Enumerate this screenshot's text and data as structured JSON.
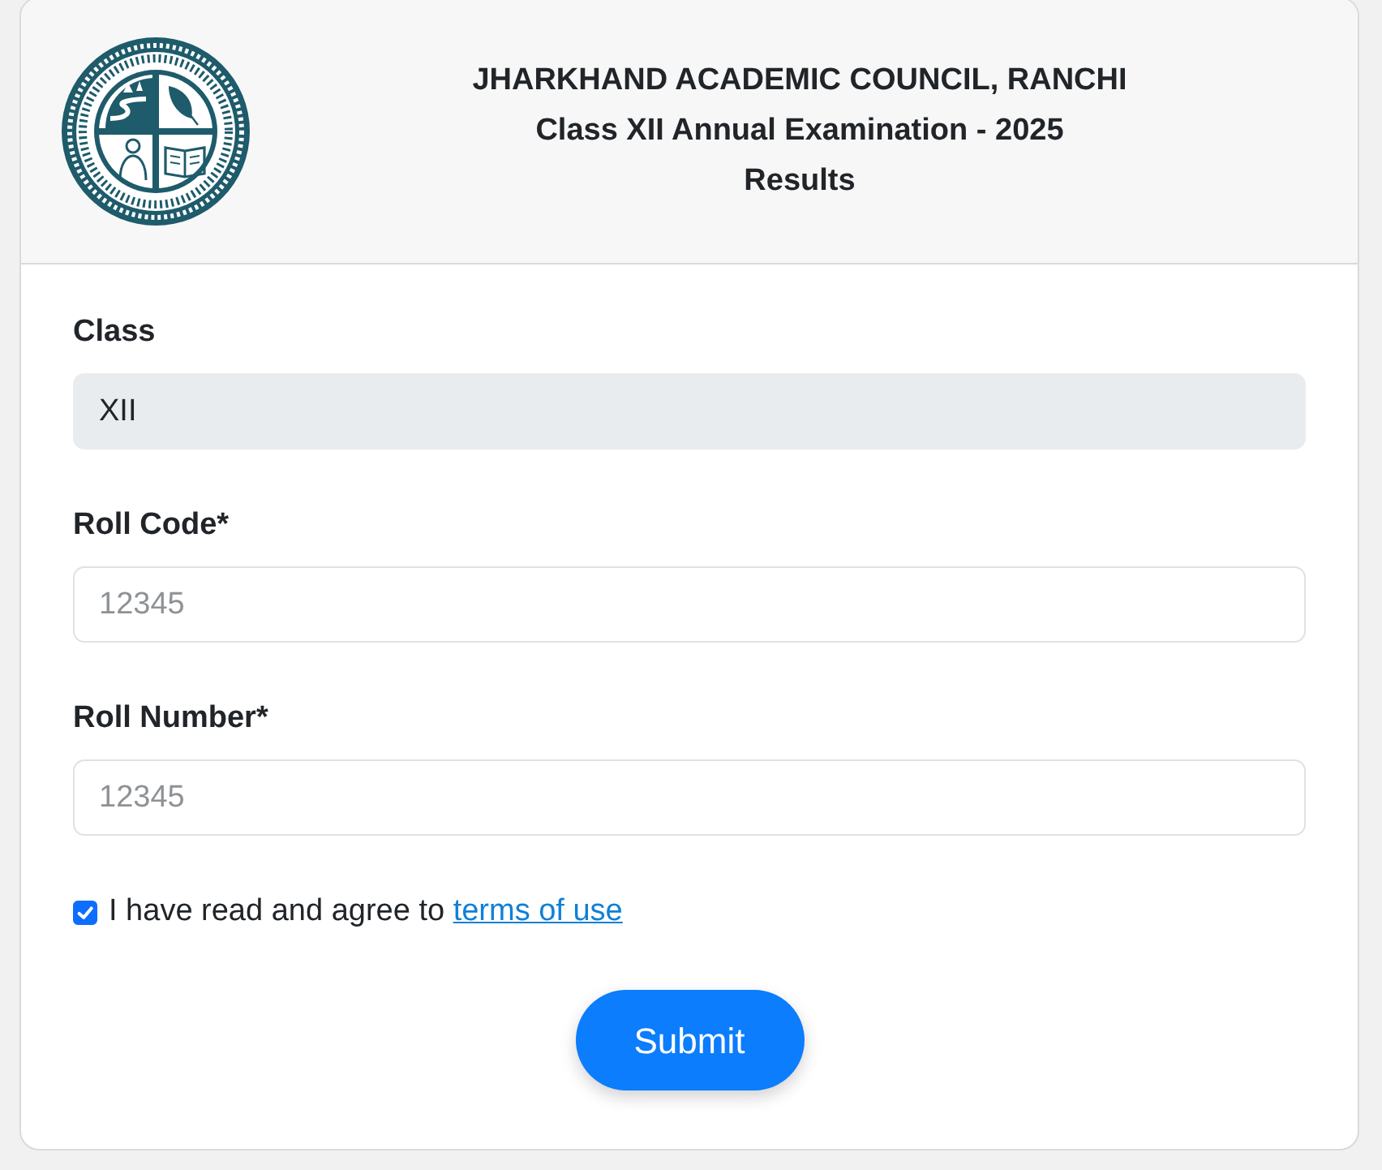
{
  "header": {
    "title": "JHARKHAND ACADEMIC COUNCIL, RANCHI",
    "subtitle": "Class XII Annual Examination - 2025",
    "heading": "Results"
  },
  "fields": [
    {
      "label": "Class",
      "value": "XII",
      "disabled": true
    },
    {
      "label": "Roll Code*",
      "placeholder": "12345",
      "disabled": false
    },
    {
      "label": "Roll Number*",
      "placeholder": "12345",
      "disabled": false
    }
  ],
  "agreement": {
    "checked": true,
    "text": "I have read and agree to ",
    "link": "terms of use"
  },
  "submit": {
    "label": "Submit"
  }
}
